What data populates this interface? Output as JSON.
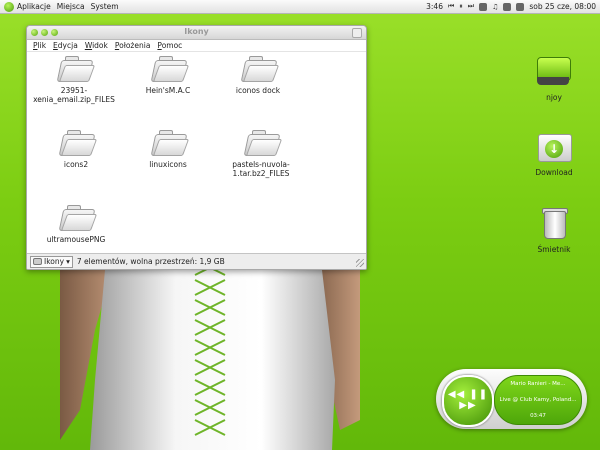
{
  "panel": {
    "menus": [
      "Aplikacje",
      "Miejsca",
      "System"
    ],
    "time": "3:46",
    "date": "sob 25 cze, 08:00"
  },
  "window": {
    "title": "Ikony",
    "menus": [
      "Plik",
      "Edycja",
      "Widok",
      "Położenia",
      "Pomoc"
    ],
    "folders": [
      {
        "label": "23951-xenia_email.zip_FILES"
      },
      {
        "label": "Hein'sM.A.C"
      },
      {
        "label": "iconos dock"
      },
      {
        "label": "icons2"
      },
      {
        "label": "linuxicons"
      },
      {
        "label": "pastels-nuvola-1.tar.bz2_FILES"
      },
      {
        "label": "ultramousePNG"
      }
    ],
    "status": {
      "location": "Ikony",
      "summary": "7 elementów, wolna przestrzeń: 1,9 GB"
    }
  },
  "desktop": {
    "icons": [
      {
        "label": "njoy",
        "icon": "drive-icon"
      },
      {
        "label": "Download",
        "icon": "download-folder-icon"
      },
      {
        "label": "Śmietnik",
        "icon": "trash-icon"
      }
    ]
  },
  "player": {
    "controls": "◀◀ ❚❚ ▶▶",
    "artist": "Mario Ranieri - Me...",
    "track": "Live @ Club Kamy, Poland...",
    "time": "03:47"
  }
}
